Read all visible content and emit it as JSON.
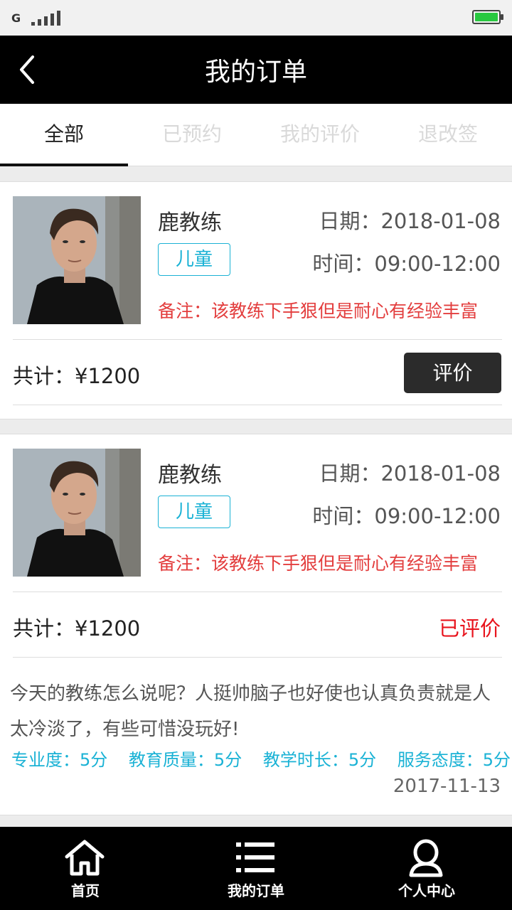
{
  "status_bar": {
    "carrier": "G",
    "battery_color": "#28c840"
  },
  "header": {
    "title": "我的订单"
  },
  "tabs": [
    {
      "label": "全部",
      "active": true
    },
    {
      "label": "已预约",
      "active": false
    },
    {
      "label": "我的评价",
      "active": false
    },
    {
      "label": "退改签",
      "active": false
    }
  ],
  "orders": [
    {
      "coach_name": "鹿教练",
      "tag": "儿童",
      "date": "日期：2018-01-08",
      "time": "时间：09:00-12:00",
      "remark": "备注：该教练下手狠但是耐心有经验丰富",
      "total": "共计：¥1200",
      "action_label": "评价"
    },
    {
      "coach_name": "鹿教练",
      "tag": "儿童",
      "date": "日期：2018-01-08",
      "time": "时间：09:00-12:00",
      "remark": "备注：该教练下手狠但是耐心有经验丰富",
      "total": "共计：¥1200",
      "status": "已评价",
      "review": {
        "text": "今天的教练怎么说呢？人挺帅脑子也好使也认真负责就是人太冷淡了，有些可惜没玩好!",
        "scores": [
          "专业度：5分",
          "教育质量：5分",
          "教学时长：5分",
          "服务态度：5分"
        ],
        "date": "2017-11-13"
      }
    }
  ],
  "bottom_nav": [
    {
      "label": "首页",
      "icon": "home-icon"
    },
    {
      "label": "我的订单",
      "icon": "list-icon"
    },
    {
      "label": "个人中心",
      "icon": "user-icon"
    }
  ],
  "colors": {
    "accent": "#1ab2d5",
    "remark_red": "#e33e3e",
    "rated_red": "#e8141d"
  }
}
